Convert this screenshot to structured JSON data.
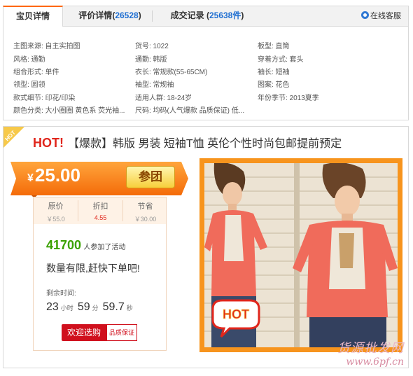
{
  "tabs": [
    {
      "label": "宝贝详情",
      "count": ""
    },
    {
      "label": "评价详情",
      "count": "26528"
    },
    {
      "label": "成交记录",
      "count": "25638件"
    }
  ],
  "service_label": "在线客服",
  "attributes": [
    [
      "主图来源: 自主实拍图",
      "货号: 1022",
      "板型: 直筒"
    ],
    [
      "风格: 通勤",
      "通勤: 韩版",
      "穿着方式: 套头"
    ],
    [
      "组合形式: 单件",
      "衣长: 常规款(55-65CM)",
      "袖长: 短袖"
    ],
    [
      "领型: 圆领",
      "袖型: 常规袖",
      "图案: 花色"
    ],
    [
      "款式细节: 印花/印染",
      "适用人群: 18-24岁",
      "年份季节: 2013夏季"
    ],
    [
      "颜色分类: 大小圈圈 黄色系 荧光袖...",
      "尺码: 均码(人气爆款 品质保证) 低...",
      ""
    ]
  ],
  "product": {
    "hot_prefix": "HOT!",
    "title": "【爆款】韩版 男装 短袖T恤 英伦个性时尚包邮提前预定",
    "corner_badge": "HOT",
    "price_symbol": "¥",
    "price": "25.00",
    "join_label": "参团",
    "stats": [
      {
        "label": "原价",
        "value": "￥55.0"
      },
      {
        "label": "折扣",
        "value": "4.55"
      },
      {
        "label": "节省",
        "value": "￥30.00"
      }
    ],
    "participants_count": "41700",
    "participants_text": "人参加了活动",
    "hurry_text": "数量有限,赶快下单吧!",
    "countdown_label": "剩余时间:",
    "countdown": {
      "hours": "23",
      "hours_unit": "小时",
      "minutes": "59",
      "minutes_unit": "分",
      "seconds": "59.7",
      "seconds_unit": "秒"
    },
    "buy_label": "欢迎选购",
    "guarantee_label": "品质保证",
    "photo_badge": "HOT",
    "watermark_cn": "货源批发网",
    "watermark_url": "www.6pf.cn"
  },
  "colors": {
    "accent_orange": "#ff7b0f",
    "tab_count_blue": "#1f6fd2",
    "hot_red": "#e0261c",
    "green_count": "#3aa100",
    "photo_frame": "#f7941d"
  }
}
